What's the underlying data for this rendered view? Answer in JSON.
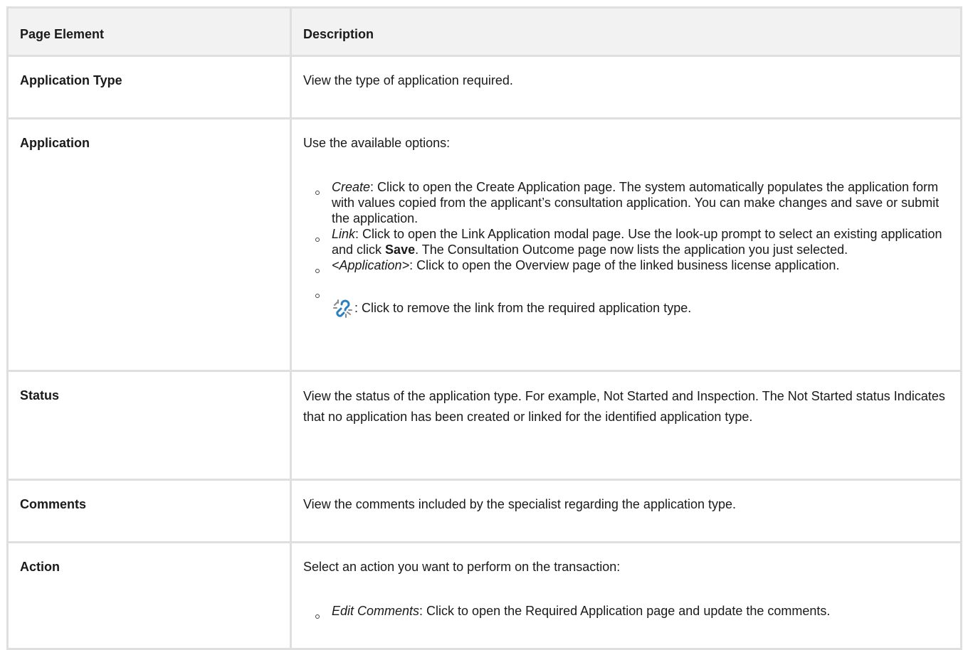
{
  "table": {
    "headers": [
      "Page Element",
      "Description"
    ],
    "rows": {
      "application_type": {
        "element": "Application Type",
        "description": "View the type of application required."
      },
      "application": {
        "element": "Application",
        "intro": "Use the available options:",
        "options": [
          {
            "term": "Create",
            "text": ": Click to open the Create Application page. The system automatically populates the application form with values copied from the applicant’s consultation application. You can make changes and save or submit the application."
          },
          {
            "term": "Link",
            "text_before": ": Click to open the Link Application modal page. Use the look-up prompt to select an existing application and click ",
            "bold": "Save",
            "text_after": ". The Consultation Outcome page now lists the application you just selected."
          },
          {
            "term": "<Application>",
            "text": ": Click to open the Overview page of the linked business license application."
          },
          {
            "icon": "unlink-icon",
            "text": ": Click to remove the link from the required application type."
          }
        ]
      },
      "status": {
        "element": "Status",
        "description": "View the status of the application type. For example, Not Started and Inspection. The Not Started status Indicates that no application has been created or linked for the identified application type."
      },
      "comments": {
        "element": "Comments",
        "description": "View the comments included by the specialist regarding the application type."
      },
      "action": {
        "element": "Action",
        "intro": "Select an action you want to perform on the transaction:",
        "options": [
          {
            "term": "Edit Comments",
            "text": ": Click to open the Required Application page and update the comments."
          }
        ]
      }
    }
  },
  "colors": {
    "header_bg": "#f2f2f2",
    "border": "#dfdfdf",
    "icon_blue": "#2a7fc1",
    "icon_gray": "#8a8a8a"
  }
}
